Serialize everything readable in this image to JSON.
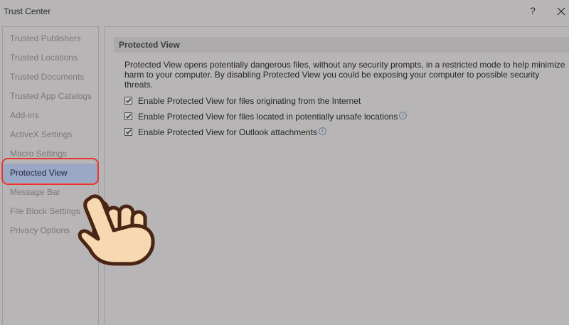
{
  "window": {
    "title": "Trust Center",
    "help_label": "?"
  },
  "sidebar": {
    "items": [
      {
        "label": "Trusted Publishers"
      },
      {
        "label": "Trusted Locations"
      },
      {
        "label": "Trusted Documents"
      },
      {
        "label": "Trusted App Catalogs"
      },
      {
        "label": "Add-ins"
      },
      {
        "label": "ActiveX Settings"
      },
      {
        "label": "Macro Settings"
      },
      {
        "label": "Protected View",
        "selected": true
      },
      {
        "label": "Message Bar"
      },
      {
        "label": "File Block Settings"
      },
      {
        "label": "Privacy Options"
      }
    ]
  },
  "main": {
    "section_title": "Protected View",
    "description": "Protected View opens potentially dangerous files, without any security prompts, in a restricted mode to help minimize harm to your computer. By disabling Protected View you could be exposing your computer to possible security threats.",
    "options": [
      {
        "label": "Enable Protected View for files originating from the Internet",
        "checked": true
      },
      {
        "label": "Enable Protected View for files located in potentially unsafe locations",
        "checked": true,
        "info": "i"
      },
      {
        "label": "Enable Protected View for Outlook attachments",
        "checked": true,
        "info": "i"
      }
    ]
  },
  "colors": {
    "selected_item": "#9aa8c5",
    "highlight_ring": "#e8342b",
    "hand_fill": "#f6d9b0",
    "hand_outline": "#4a2414"
  },
  "icons": {
    "close": "close-icon",
    "help": "help-icon",
    "info": "info-icon",
    "checkbox": "checkmark-icon",
    "pointer": "pointing-hand-icon"
  }
}
